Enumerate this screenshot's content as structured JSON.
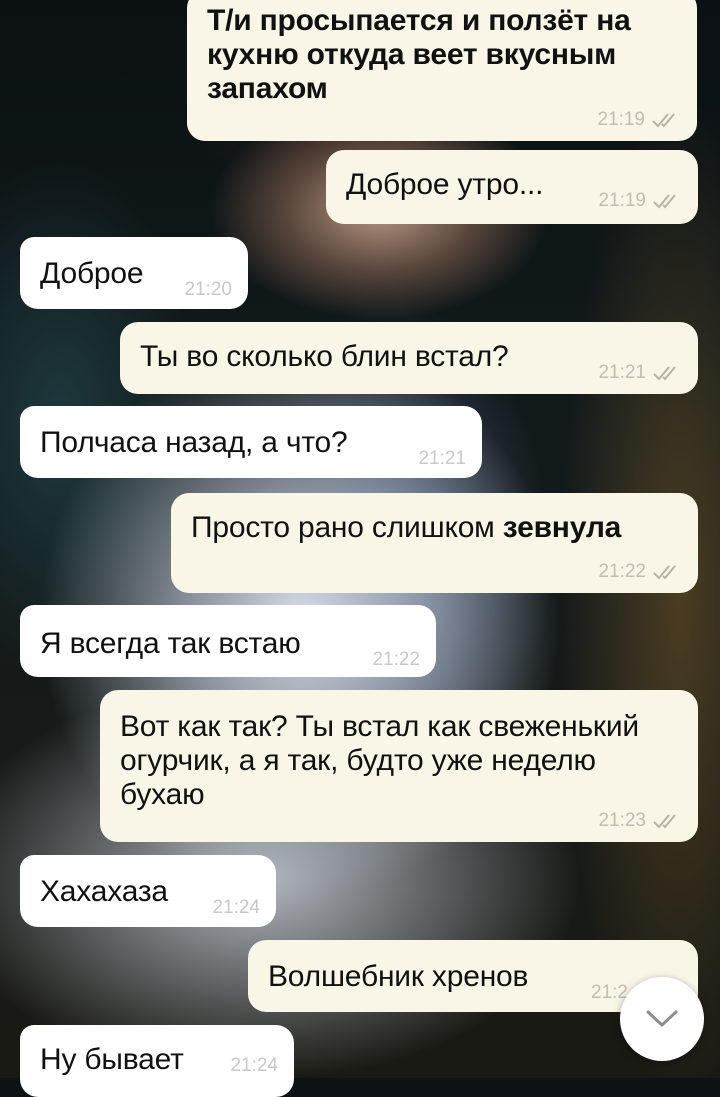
{
  "wallpaper": {
    "description_icon": "photo-wallpaper"
  },
  "messages": [
    {
      "direction": "out",
      "text": "Т/и просыпается и ползёт на кухню откуда веет вкусным запахом",
      "time": "21:19",
      "read": true,
      "bold": true
    },
    {
      "direction": "out",
      "text": "Доброе утро...",
      "time": "21:19",
      "read": true
    },
    {
      "direction": "in",
      "text": "Доброе",
      "time": "21:20"
    },
    {
      "direction": "out",
      "text": "Ты во сколько блин встал?",
      "time": "21:21",
      "read": true
    },
    {
      "direction": "in",
      "text": "Полчаса назад, а что?",
      "time": "21:21"
    },
    {
      "direction": "out",
      "text": "Просто рано слишком",
      "text_bold": "зевнула",
      "time": "21:22",
      "read": true
    },
    {
      "direction": "in",
      "text": "Я всегда так встаю",
      "time": "21:22"
    },
    {
      "direction": "out",
      "text": "Вот как так? Ты встал как свеженький огурчик, а я так, будто уже неделю бухаю",
      "time": "21:23",
      "read": true
    },
    {
      "direction": "in",
      "text": "Хахахаза",
      "time": "21:24"
    },
    {
      "direction": "out",
      "text": "Волшебник хренов",
      "time": "21:2",
      "read": true
    },
    {
      "direction": "in",
      "text": "Ну бывает",
      "time": "21:24"
    }
  ],
  "scroll_button": {
    "icon": "chevron-down-icon"
  },
  "colors": {
    "incoming_bubble": "#ffffff",
    "outgoing_bubble": "#f9f6e8",
    "timestamp": "#c0bdb3",
    "read_ticks": "#b7b3a6"
  }
}
